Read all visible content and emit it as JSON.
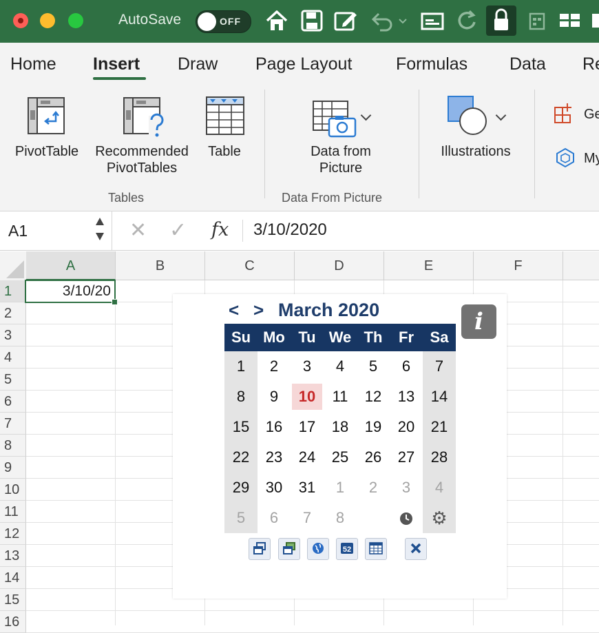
{
  "titlebar": {
    "autosave_label": "AutoSave",
    "autosave_state": "OFF"
  },
  "tabs": [
    "Home",
    "Insert",
    "Draw",
    "Page Layout",
    "Formulas",
    "Data",
    "Re"
  ],
  "active_tab": "Insert",
  "ribbon": {
    "pivottable": "PivotTable",
    "recommended_line1": "Recommended",
    "recommended_line2": "PivotTables",
    "table": "Table",
    "data_from_picture_line1": "Data from",
    "data_from_picture_line2": "Picture",
    "illustrations": "Illustrations",
    "get_addins": "Ge",
    "my_addins": "My",
    "group_tables": "Tables",
    "group_data_from_picture": "Data From Picture"
  },
  "formula_bar": {
    "name_box": "A1",
    "fx": "fx",
    "value": "3/10/2020"
  },
  "grid": {
    "columns": [
      "A",
      "B",
      "C",
      "D",
      "E",
      "F"
    ],
    "rows": [
      "1",
      "2",
      "3",
      "4",
      "5",
      "6",
      "7",
      "8",
      "9",
      "10",
      "11",
      "12",
      "13",
      "14",
      "15",
      "16"
    ],
    "selected_cell": "A1",
    "a1_display": "3/10/20"
  },
  "calendar": {
    "prev": "<",
    "next": ">",
    "title": "March 2020",
    "info": "i",
    "weekdays": [
      "Su",
      "Mo",
      "Tu",
      "We",
      "Th",
      "Fr",
      "Sa"
    ],
    "weeks": [
      [
        "1",
        "2",
        "3",
        "4",
        "5",
        "6",
        "7"
      ],
      [
        "8",
        "9",
        "10",
        "11",
        "12",
        "13",
        "14"
      ],
      [
        "15",
        "16",
        "17",
        "18",
        "19",
        "20",
        "21"
      ],
      [
        "22",
        "23",
        "24",
        "25",
        "26",
        "27",
        "28"
      ],
      [
        "29",
        "30",
        "31",
        "1",
        "2",
        "3",
        "4"
      ],
      [
        "5",
        "6",
        "7",
        "8",
        "",
        "",
        ""
      ]
    ],
    "today": "10",
    "colors": {
      "header": "#173663",
      "title": "#1f3d6b",
      "today": "#c62828",
      "today_bg": "#f6d7d7"
    }
  },
  "colors": {
    "titlebar": "#2f7043",
    "accent": "#2f7043"
  }
}
